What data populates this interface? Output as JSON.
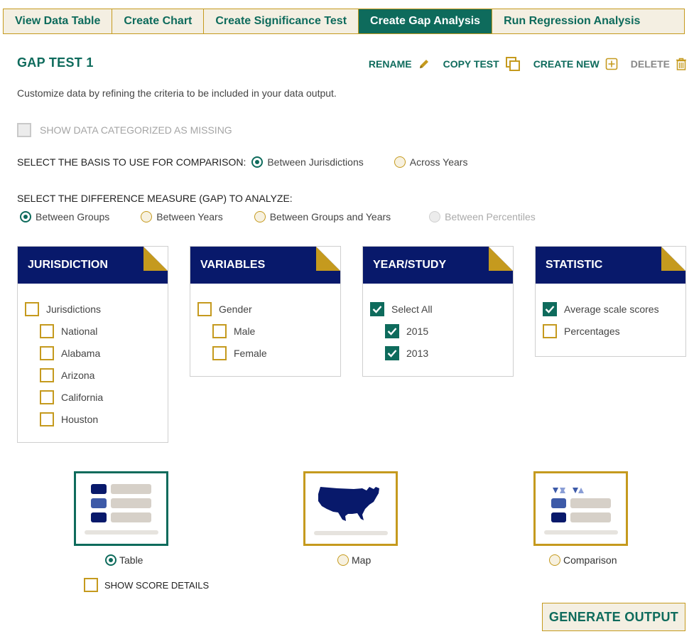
{
  "tabs": [
    {
      "label": "View Data Table",
      "active": false
    },
    {
      "label": "Create Chart",
      "active": false
    },
    {
      "label": "Create Significance Test",
      "active": false
    },
    {
      "label": "Create Gap Analysis",
      "active": true
    },
    {
      "label": "Run Regression Analysis",
      "active": false
    }
  ],
  "header": {
    "title": "GAP TEST 1",
    "rename": "RENAME",
    "copy": "COPY TEST",
    "create_new": "CREATE NEW",
    "delete": "DELETE"
  },
  "description": "Customize data by refining the criteria to be included in your data output.",
  "missing_option": "SHOW DATA CATEGORIZED AS MISSING",
  "comparison": {
    "label": "SELECT THE BASIS TO USE FOR COMPARISON:",
    "options": [
      "Between Jurisdictions",
      "Across Years"
    ],
    "selected": "Between Jurisdictions"
  },
  "gap": {
    "label": "SELECT THE DIFFERENCE MEASURE (GAP) TO ANALYZE:",
    "options": [
      "Between Groups",
      "Between Years",
      "Between Groups and Years",
      "Between Percentiles"
    ],
    "selected": "Between Groups",
    "disabled": [
      "Between Percentiles"
    ]
  },
  "panels": {
    "jurisdiction": {
      "title": "JURISDICTION",
      "parent": "Jurisdictions",
      "items": [
        "National",
        "Alabama",
        "Arizona",
        "California",
        "Houston"
      ]
    },
    "variables": {
      "title": "VARIABLES",
      "parent": "Gender",
      "items": [
        "Male",
        "Female"
      ]
    },
    "year": {
      "title": "YEAR/STUDY",
      "parent": "Select All",
      "items": [
        "2015",
        "2013"
      ]
    },
    "statistic": {
      "title": "STATISTIC",
      "items": [
        "Average scale scores",
        "Percentages"
      ]
    }
  },
  "output": {
    "options": [
      "Table",
      "Map",
      "Comparison"
    ],
    "selected": "Table",
    "show_details": "SHOW SCORE DETAILS"
  },
  "generate": "GENERATE OUTPUT",
  "colors": {
    "teal": "#0e6b5c",
    "gold": "#c59a1e",
    "navy": "#08196b",
    "tab_bg": "#f4efe2"
  }
}
